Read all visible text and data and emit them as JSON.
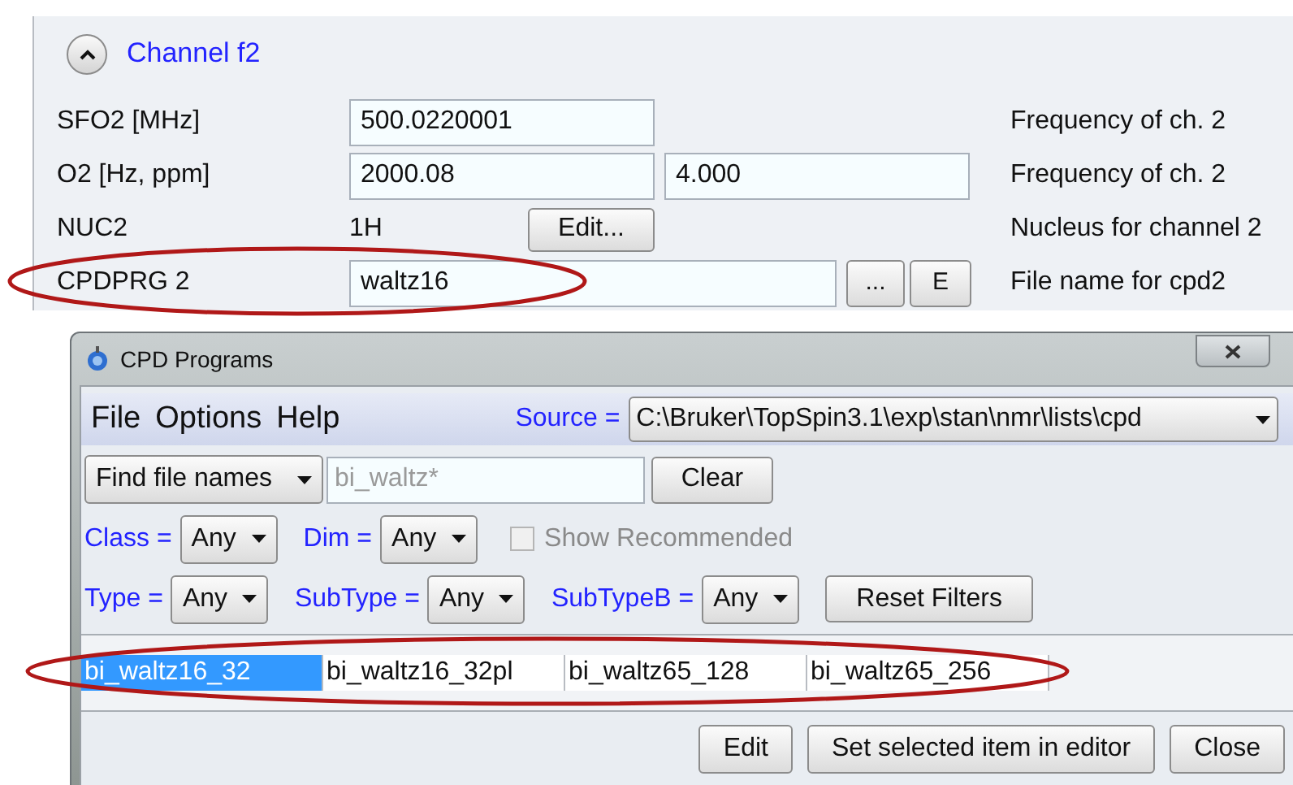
{
  "panel": {
    "section": {
      "title": "Channel f2",
      "expanded": true
    },
    "rows": [
      {
        "kind": "field",
        "label": "SFO2 [MHz]",
        "fields": [
          "500.0220001"
        ],
        "description": "Frequency of ch. 2"
      },
      {
        "kind": "field",
        "label": "O2 [Hz, ppm]",
        "fields": [
          "2000.08",
          "4.000"
        ],
        "description": "Frequency of ch. 2"
      },
      {
        "kind": "value",
        "label": "NUC2",
        "value": "1H",
        "buttons": [
          "Edit..."
        ],
        "description": "Nucleus for channel 2"
      },
      {
        "kind": "program",
        "label": "CPDPRG 2",
        "fields": [
          "waltz16"
        ],
        "buttons": [
          "...",
          "E"
        ],
        "description": "File name for cpd2"
      }
    ]
  },
  "dialog": {
    "title": "CPD Programs",
    "menu": [
      "File",
      "Options",
      "Help"
    ],
    "source": {
      "label": "Source =",
      "value": "C:\\Bruker\\TopSpin3.1\\exp\\stan\\nmr\\lists\\cpd"
    },
    "find": {
      "mode": "Find file names",
      "placeholder": "bi_waltz*",
      "button": "Clear"
    },
    "filter_rows": [
      {
        "filters": [
          {
            "label": "Class =",
            "value": "Any"
          },
          {
            "label": "Dim =",
            "value": "Any"
          }
        ],
        "checkbox": {
          "label": "Show Recommended",
          "checked": false,
          "disabled": true
        }
      },
      {
        "filters": [
          {
            "label": "Type =",
            "value": "Any"
          },
          {
            "label": "SubType =",
            "value": "Any"
          },
          {
            "label": "SubTypeB =",
            "value": "Any"
          }
        ],
        "button": "Reset Filters"
      }
    ],
    "files": [
      {
        "name": "bi_waltz16_32",
        "selected": true
      },
      {
        "name": "bi_waltz16_32pl",
        "selected": false
      },
      {
        "name": "bi_waltz65_128",
        "selected": false
      },
      {
        "name": "bi_waltz65_256",
        "selected": false
      }
    ],
    "buttons": [
      "Edit",
      "Set selected item in editor",
      "Close"
    ]
  }
}
